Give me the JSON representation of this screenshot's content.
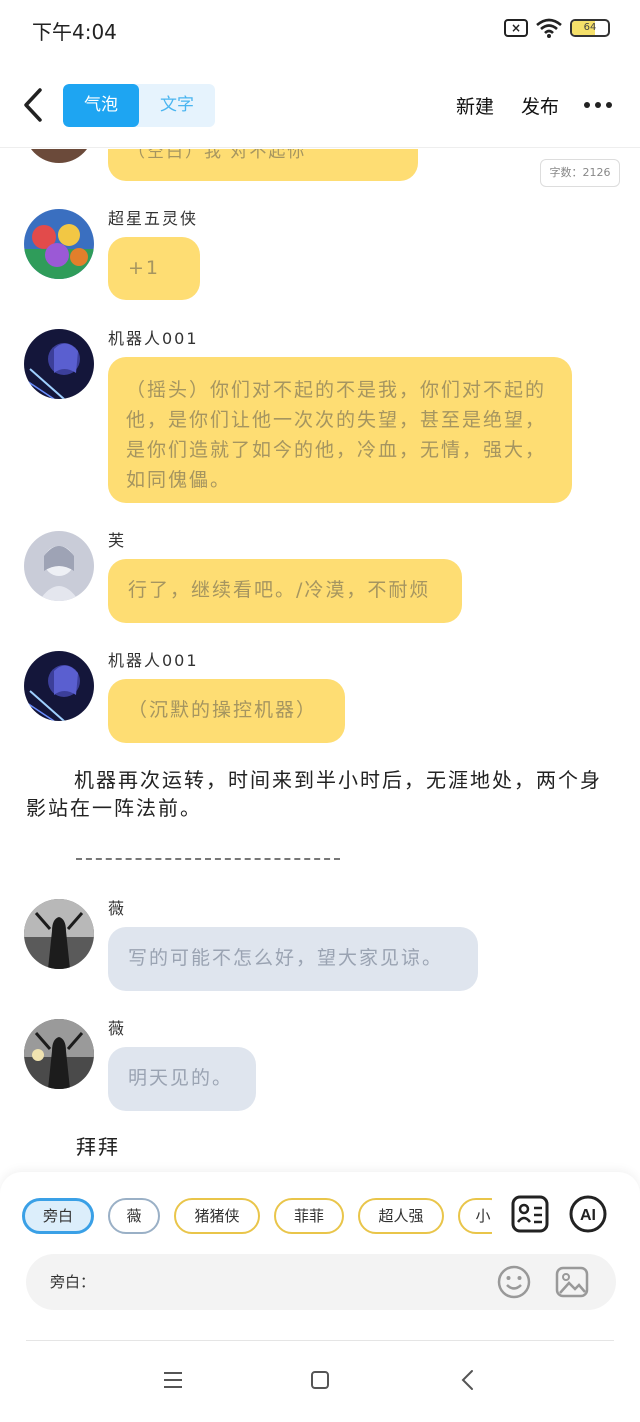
{
  "status": {
    "time": "下午4:04",
    "battery": "64"
  },
  "header": {
    "tab_bubble": "气泡",
    "tab_text": "文字",
    "new_label": "新建",
    "publish_label": "发布"
  },
  "chat": {
    "word_count": "字数：2126",
    "top_partial": "（空白）我    对不起你",
    "messages": [
      {
        "name": "超星五灵侠",
        "text": "+1"
      },
      {
        "name": "机器人001",
        "text": "（摇头）你们对不起的不是我，你们对不起的他，是你们让他一次次的失望，甚至是绝望，是你们造就了如今的他，冷血，无情，强大，如同傀儡。"
      },
      {
        "name": "芙",
        "text": "行了，继续看吧。/冷漠，不耐烦"
      },
      {
        "name": "机器人001",
        "text": "（沉默的操控机器）"
      }
    ],
    "narration": "机器再次运转，时间来到半小时后，无涯地处，两个身影站在一阵法前。",
    "messages2": [
      {
        "name": "薇",
        "text": "写的可能不怎么好，望大家见谅。"
      },
      {
        "name": "薇",
        "text": "明天见的。"
      }
    ],
    "closing": "拜拜"
  },
  "roles": [
    "旁白",
    "薇",
    "猪猪侠",
    "菲菲",
    "超人强",
    "小"
  ],
  "input": {
    "label": "旁白："
  },
  "colors": {
    "accent": "#1ea5f2",
    "bubble_yellow": "#fedd73",
    "bubble_grey": "#dfe5ee"
  }
}
